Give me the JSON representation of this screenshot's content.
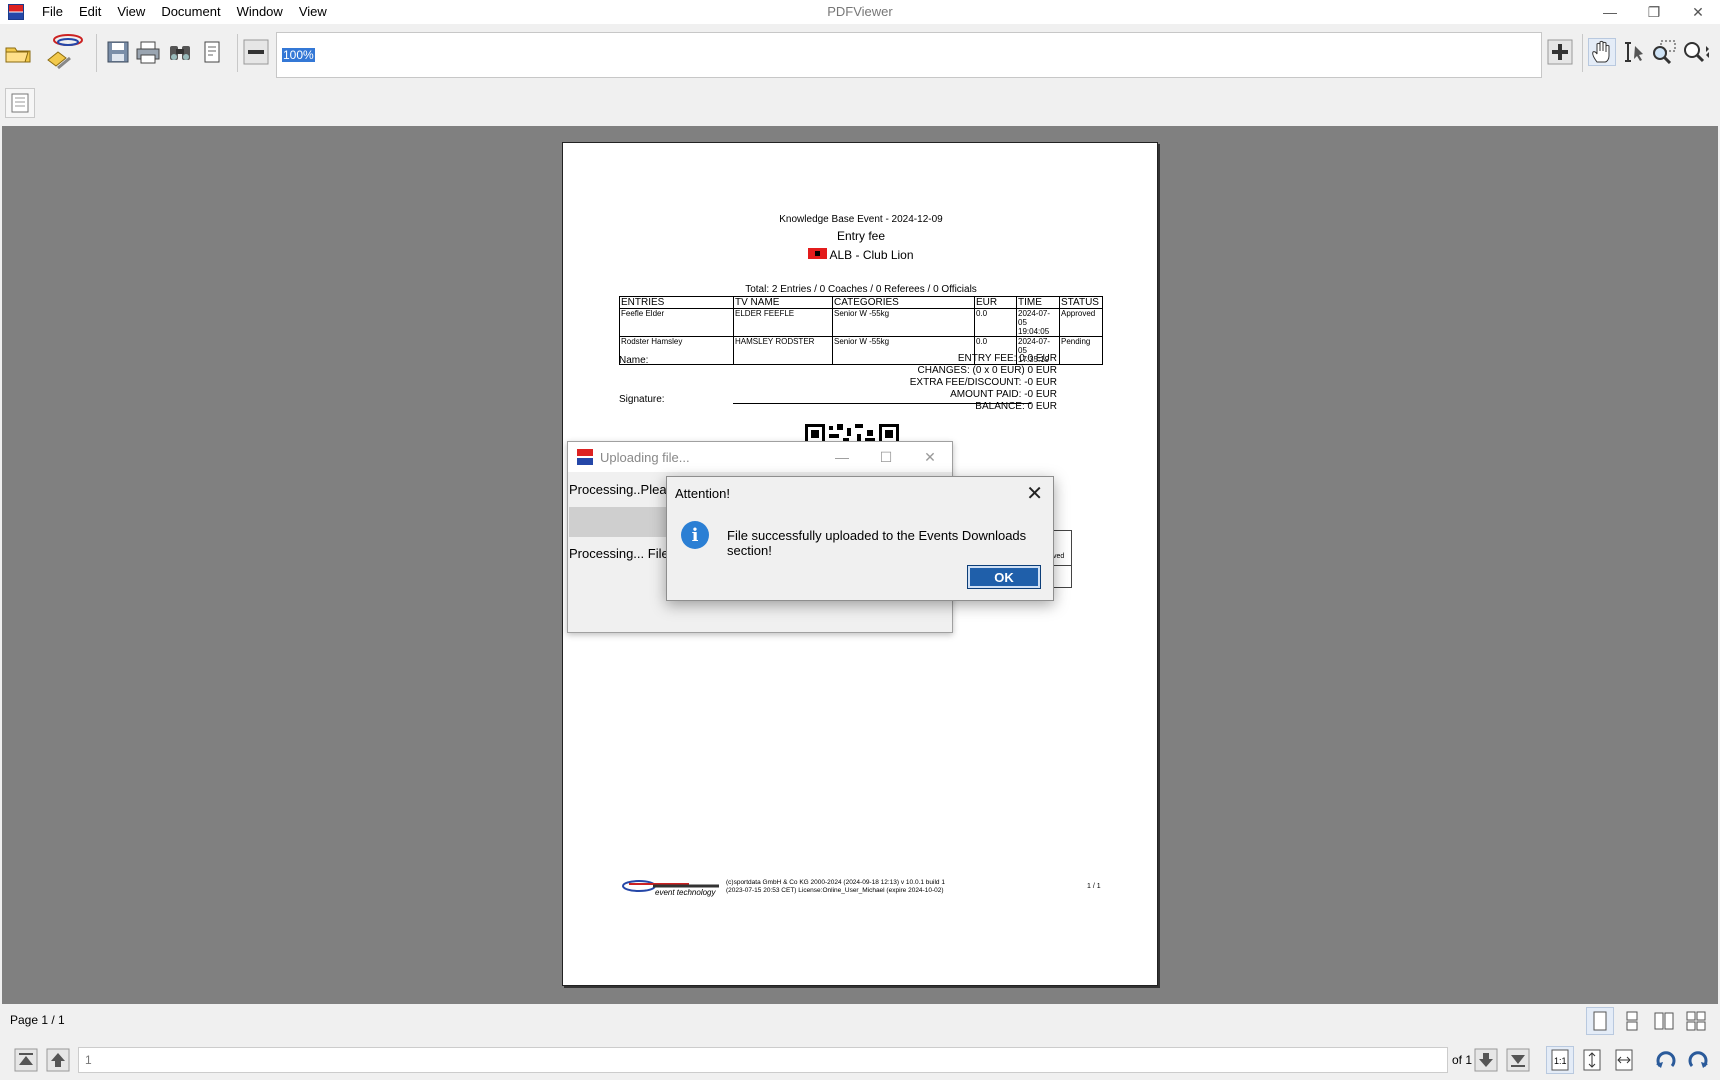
{
  "window": {
    "title": "PDFViewer",
    "menu": [
      "File",
      "Edit",
      "View",
      "Document",
      "Window",
      "View"
    ]
  },
  "toolbar": {
    "zoom_value": "100%",
    "icons_left": [
      "open-folder-icon",
      "upload-icon",
      "save-icon",
      "print-icon",
      "find-icon",
      "page-properties-icon",
      "zoom-out-icon"
    ],
    "icons_right": [
      "zoom-in-icon",
      "hand-tool-icon",
      "text-select-icon",
      "marquee-zoom-icon",
      "dynamic-zoom-icon"
    ]
  },
  "document": {
    "event": "Knowledge Base Event - 2024-12-09",
    "subtitle": "Entry fee",
    "club": "ALB - Club Lion",
    "totals": "Total: 2 Entries / 0 Coaches / 0 Referees / 0 Officials",
    "table": {
      "headers": [
        "ENTRIES",
        "TV NAME",
        "CATEGORIES",
        "EUR",
        "TIME",
        "STATUS"
      ],
      "rows": [
        [
          "Feefle Elder",
          "ELDER FEEFLE",
          "Senior W -55kg",
          "0.0",
          "2024-07-05 19:04:05",
          "Approved"
        ],
        [
          "Rodster Hamsley",
          "HAMSLEY RODSTER",
          "Senior W -55kg",
          "0.0",
          "2024-07-05 17:35:19",
          "Pending"
        ]
      ]
    },
    "name_label": "Name:",
    "signature_label": "Signature:",
    "summary": [
      "ENTRY FEE: 0.0 EUR",
      "CHANGES: (0 x 0 EUR) 0 EUR",
      "EXTRA FEE/DISCOUNT: -0 EUR",
      "AMOUNT PAID: -0 EUR",
      "BALANCE: 0 EUR"
    ],
    "footer_logo_text": "event technology",
    "footer_line1": "(c)sportdata GmbH & Co KG 2000-2024 (2024-09-18 12:13) v 10.0.1 build 1",
    "footer_line2": "(2023-07-15 20:53 CET) License:Online_User_Michael (expire 2024-10-02)",
    "page_num": "1 / 1"
  },
  "upload_window": {
    "title": "Uploading file...",
    "line1": "Processing..Please",
    "line2": "Processing... File su"
  },
  "dialog": {
    "title": "Attention!",
    "message": "File successfully uploaded to the Events Downloads section!",
    "ok_label": "OK"
  },
  "behind_fragment": "ved",
  "status": {
    "page_label": "Page 1 / 1",
    "page_input": "1",
    "of_pages": "of 1"
  }
}
